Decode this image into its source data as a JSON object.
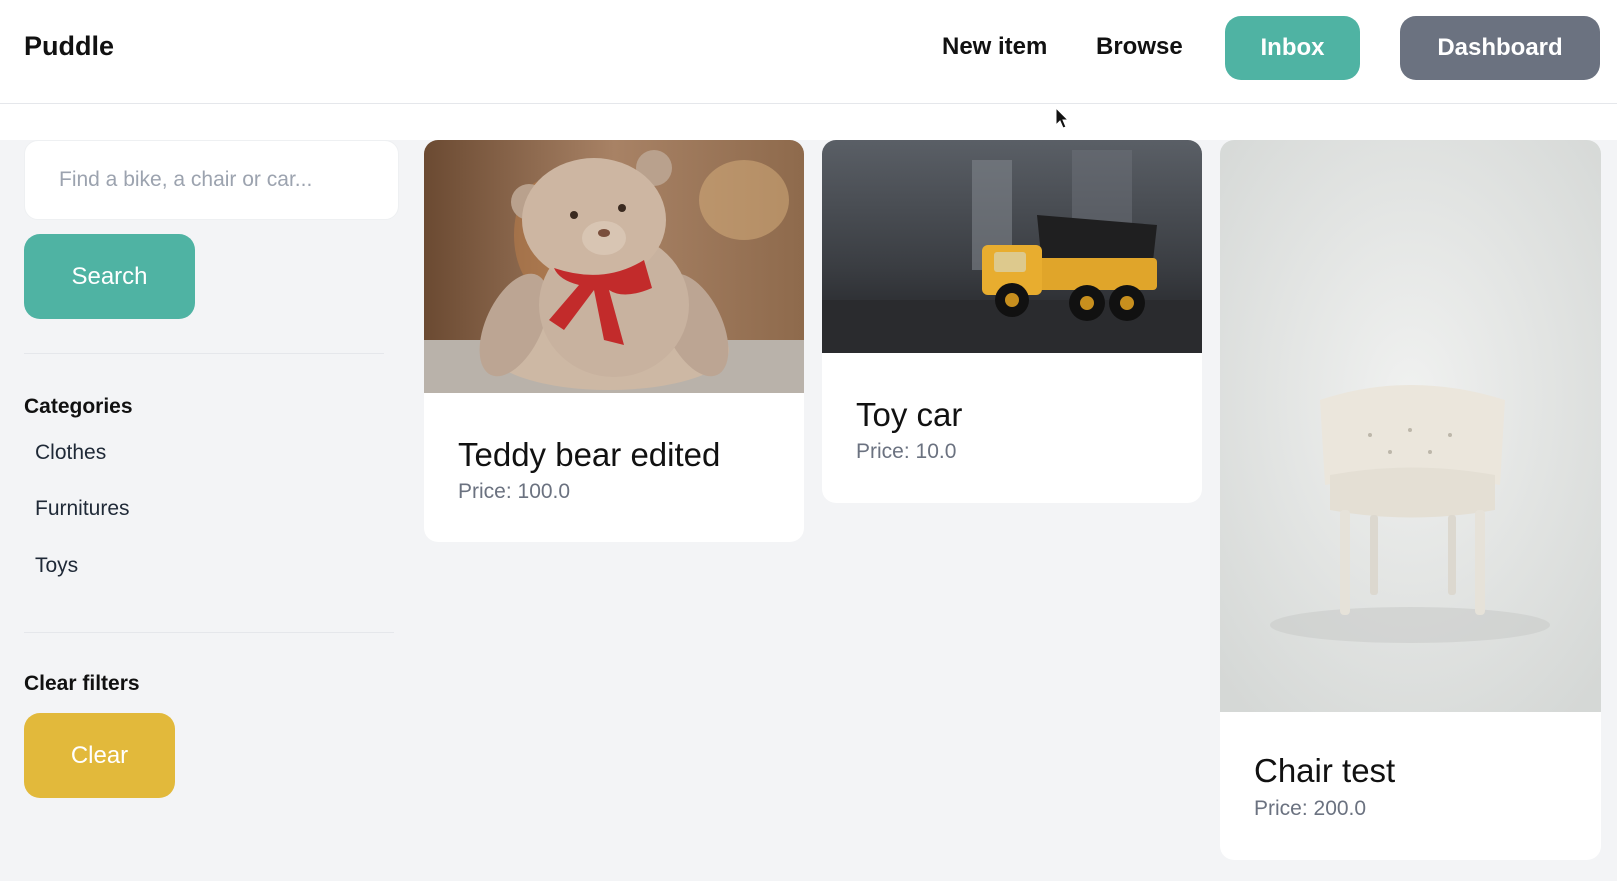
{
  "app": {
    "logo": "Puddle"
  },
  "nav": {
    "new_item": "New item",
    "browse": "Browse",
    "inbox": "Inbox",
    "dashboard": "Dashboard"
  },
  "sidebar": {
    "search_placeholder": "Find a bike, a chair or car...",
    "search_button": "Search",
    "categories_title": "Categories",
    "categories": [
      "Clothes",
      "Furnitures",
      "Toys"
    ],
    "clear_title": "Clear filters",
    "clear_button": "Clear"
  },
  "items": [
    {
      "title": "Teddy bear edited",
      "price": "Price: 100.0"
    },
    {
      "title": "Toy car",
      "price": "Price: 10.0"
    },
    {
      "title": "Chair test",
      "price": "Price: 200.0"
    }
  ],
  "colors": {
    "primary": "#4fb3a3",
    "secondary": "#6b7280",
    "warning": "#e2b93b"
  }
}
